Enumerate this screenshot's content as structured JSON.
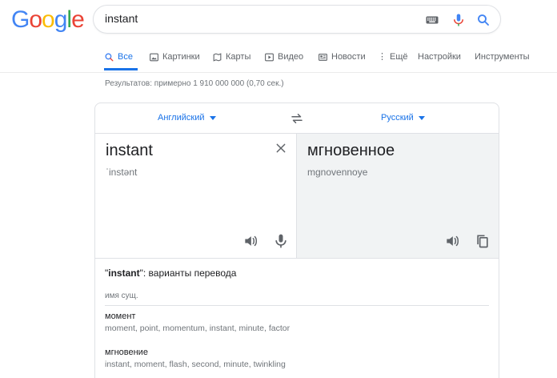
{
  "logo": {
    "letters": [
      "G",
      "o",
      "o",
      "g",
      "l",
      "e"
    ],
    "colors": [
      "#4285F4",
      "#EA4335",
      "#FBBC05",
      "#4285F4",
      "#34A853",
      "#EA4335"
    ]
  },
  "search": {
    "query": "instant"
  },
  "tabs": {
    "all": "Все",
    "images": "Картинки",
    "maps": "Карты",
    "video": "Видео",
    "news": "Новости",
    "more": "Ещё",
    "settings": "Настройки",
    "tools": "Инструменты"
  },
  "results_text": "Результатов: примерно 1 910 000 000 (0,70 сек.)",
  "translate": {
    "source_lang": "Английский",
    "target_lang": "Русский",
    "source_text": "instant",
    "source_phonetic": "ˈinstənt",
    "target_text": "мгновенное",
    "target_phonetic": "mgnovennoye"
  },
  "variants": {
    "word": "instant",
    "suffix": ": варианты перевода",
    "part_of_speech": "имя сущ.",
    "entries": [
      {
        "word": "момент",
        "synonyms": "moment, point, momentum, instant, minute, factor"
      },
      {
        "word": "мгновение",
        "synonyms": "instant, moment, flash, second, minute, twinkling"
      }
    ]
  },
  "colors": {
    "accent": "#1a73e8",
    "pane_bg": "#f1f3f4"
  }
}
